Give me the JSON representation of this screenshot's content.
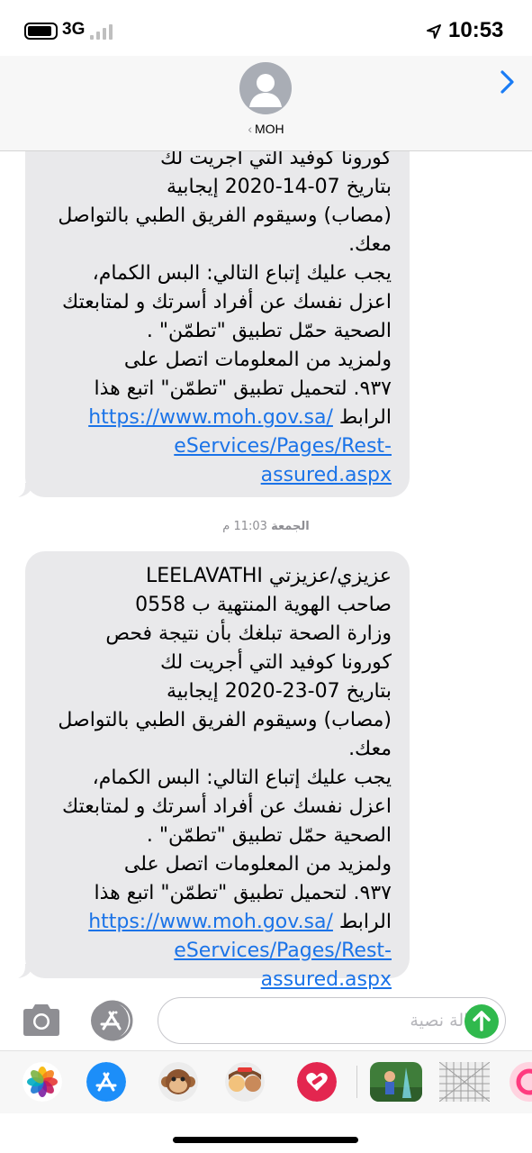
{
  "status_bar": {
    "network": "3G",
    "time": "10:53",
    "icons": [
      "battery-icon",
      "signal-icon",
      "location-arrow-icon"
    ]
  },
  "header": {
    "contact_name": "MOH",
    "back_chevron": "‹",
    "icons": [
      "avatar-icon",
      "chevron-right-icon"
    ],
    "accent_color": "#1a7cf5"
  },
  "messages": [
    {
      "text": "وزارة الصحة تبلغك بأن نتيجة فحص\nكورونا كوفيد التي أجريت لك\nبتاريخ 07-14-2020 إيجابية\n(مصاب) وسيقوم الفريق الطبي بالتواصل\nمعك.\nيجب عليك إتباع التالي: البس الكمام،\nاعزل نفسك عن أفراد أسرتك و لمتابعتك\nالصحية حمّل تطبيق \"تطمّن\" .\nولمزيد من المعلومات اتصل على\n٩٣٧. لتحميل تطبيق \"تطمّن\" اتبع هذا\nالرابط ",
      "link_line1": "https://www.moh.gov.sa/",
      "link_line2": "eServices/Pages/Rest-assured.aspx"
    },
    {
      "text": "عزيزي/عزيزتي LEELAVATHI\nصاحب الهوية المنتهية ب 0558\nوزارة الصحة تبلغك بأن نتيجة فحص\nكورونا كوفيد التي أجريت لك\nبتاريخ 07-23-2020 إيجابية\n(مصاب) وسيقوم الفريق الطبي بالتواصل\nمعك.\nيجب عليك إتباع التالي: البس الكمام،\nاعزل نفسك عن أفراد أسرتك و لمتابعتك\nالصحية حمّل تطبيق \"تطمّن\" .\nولمزيد من المعلومات اتصل على\n٩٣٧. لتحميل تطبيق \"تطمّن\" اتبع هذا\nالرابط ",
      "link_line1": "https://www.moh.gov.sa/",
      "link_line2": "eServices/Pages/Rest-assured.aspx"
    }
  ],
  "timestamp": {
    "day": "الجمعة",
    "time": "11:03 م"
  },
  "input": {
    "placeholder": "رسالة نصية",
    "value": "",
    "send_color": "#30b94d"
  },
  "app_drawer": {
    "icons": [
      "photos-icon",
      "app-store-icon",
      "monkey-animoji-icon",
      "memoji-icon",
      "heart-sticker-icon",
      "game-icon",
      "grid-pattern-icon",
      "partial-app-icon"
    ]
  },
  "colors": {
    "bubble": "#e9e9eb",
    "link": "#1a73e8",
    "header_bg": "#f7f7f7"
  }
}
